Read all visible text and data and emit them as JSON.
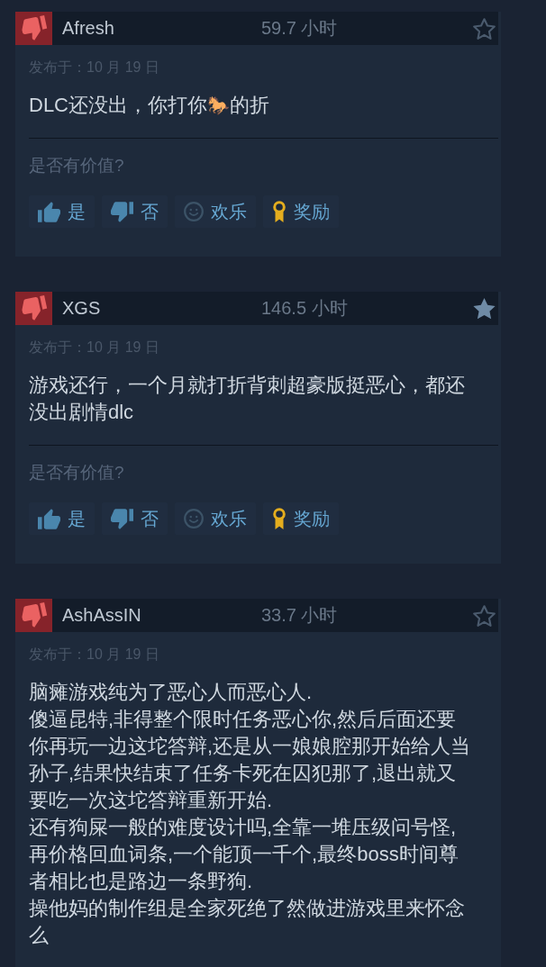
{
  "reviews": [
    {
      "recommended": false,
      "username": "Afresh",
      "hours": "59.7 小时",
      "starred": false,
      "posted": "发布于：10 月 19 日",
      "text": "DLC还没出，你打你🐎的折",
      "question": "是否有价值?",
      "actions": [
        {
          "kind": "yes",
          "label": "是"
        },
        {
          "kind": "no",
          "label": "否"
        },
        {
          "kind": "funny",
          "label": "欢乐"
        },
        {
          "kind": "award",
          "label": "奖励"
        }
      ]
    },
    {
      "recommended": false,
      "username": "XGS",
      "hours": "146.5 小时",
      "starred": true,
      "posted": "发布于：10 月 19 日",
      "text": "游戏还行，一个月就打折背刺超豪版挺恶心，都还没出剧情dlc",
      "question": "是否有价值?",
      "actions": [
        {
          "kind": "yes",
          "label": "是"
        },
        {
          "kind": "no",
          "label": "否"
        },
        {
          "kind": "funny",
          "label": "欢乐"
        },
        {
          "kind": "award",
          "label": "奖励"
        }
      ]
    },
    {
      "recommended": false,
      "username": "AshAssIN",
      "hours": "33.7 小时",
      "starred": false,
      "posted": "发布于：10 月 19 日",
      "text": "脑瘫游戏纯为了恶心人而恶心人.\n傻逼昆特,非得整个限时任务恶心你,然后后面还要你再玩一边这坨答辩,还是从一娘娘腔那开始给人当孙子,结果快结束了任务卡死在囚犯那了,退出就又要吃一次这坨答辩重新开始.\n还有狗屎一般的难度设计吗,全靠一堆压级问号怪,再价格回血词条,一个能顶一千个,最终boss时间尊者相比也是路边一条野狗.\n操他妈的制作组是全家死绝了然做进游戏里来怀念么"
    }
  ]
}
